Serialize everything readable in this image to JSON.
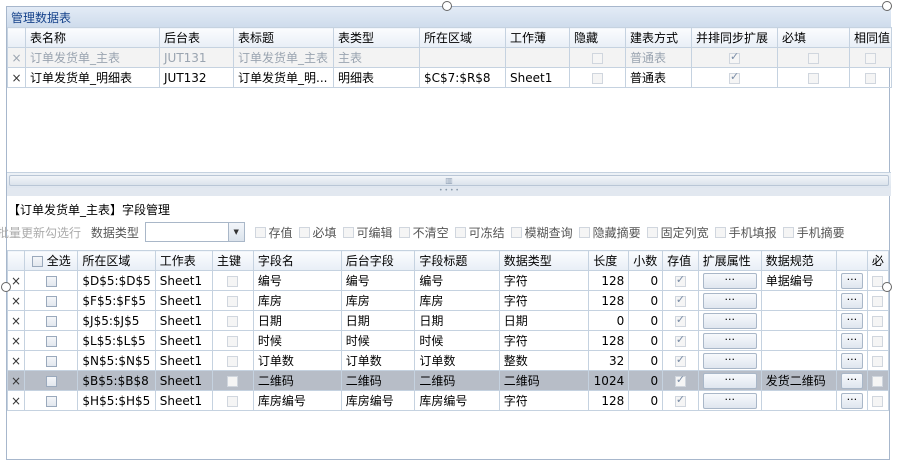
{
  "group_title": "管理数据表",
  "tables": {
    "headers": [
      "表名称",
      "后台表",
      "表标题",
      "表类型",
      "所在区域",
      "工作薄",
      "隐藏",
      "建表方式",
      "并排同步扩展",
      "必填",
      "相同值"
    ],
    "rows": [
      {
        "x": "×",
        "name": "订单发货单_主表",
        "backend": "JUT131",
        "title": "订单发货单_主表",
        "type": "主表",
        "range": "",
        "book": "",
        "hidden": false,
        "method": "普通表",
        "sync": true,
        "required": false,
        "same": false
      },
      {
        "x": "×",
        "name": "订单发货单_明细表",
        "backend": "JUT132",
        "title": "订单发货单_明...",
        "type": "明细表",
        "range": "$C$7:$R$8",
        "book": "Sheet1",
        "hidden": false,
        "method": "普通表",
        "sync": true,
        "required": false,
        "same": false
      }
    ]
  },
  "section_title": "【订单发货单_主表】字段管理",
  "toolbar": {
    "reselect": "批量更新勾选行",
    "dtype_label": "数据类型",
    "combo_value": "",
    "checks": [
      {
        "label": "存值",
        "checked": false
      },
      {
        "label": "必填",
        "checked": false
      },
      {
        "label": "可编辑",
        "checked": false
      },
      {
        "label": "不清空",
        "checked": false
      },
      {
        "label": "可冻结",
        "checked": false
      },
      {
        "label": "模糊查询",
        "checked": false
      },
      {
        "label": "隐藏摘要",
        "checked": false
      },
      {
        "label": "固定列宽",
        "checked": false
      },
      {
        "label": "手机填报",
        "checked": false
      },
      {
        "label": "手机摘要",
        "checked": false
      }
    ]
  },
  "fields": {
    "select_all": "全选",
    "headers": [
      "所在区域",
      "工作表",
      "主键",
      "字段名",
      "后台字段",
      "字段标题",
      "数据类型",
      "长度",
      "小数",
      "存值",
      "扩展属性",
      "数据规范",
      "必"
    ],
    "rows": [
      {
        "x": "×",
        "area": "$D$5:$D$5",
        "sheet": "Sheet1",
        "name": "编号",
        "backend": "编号",
        "title": "编号",
        "dtype": "字符",
        "len": "128",
        "dec": "0",
        "store": true,
        "spec": ""
      },
      {
        "x": "×",
        "area": "$F$5:$F$5",
        "sheet": "Sheet1",
        "name": "库房",
        "backend": "库房",
        "title": "库房",
        "dtype": "字符",
        "len": "128",
        "dec": "0",
        "store": true,
        "spec": ""
      },
      {
        "x": "×",
        "area": "$J$5:$J$5",
        "sheet": "Sheet1",
        "name": "日期",
        "backend": "日期",
        "title": "日期",
        "dtype": "日期",
        "len": "0",
        "dec": "0",
        "store": true,
        "spec": ""
      },
      {
        "x": "×",
        "area": "$L$5:$L$5",
        "sheet": "Sheet1",
        "name": "时候",
        "backend": "时候",
        "title": "时候",
        "dtype": "字符",
        "len": "128",
        "dec": "0",
        "store": true,
        "spec": ""
      },
      {
        "x": "×",
        "area": "$N$5:$N$5",
        "sheet": "Sheet1",
        "name": "订单数",
        "backend": "订单数",
        "title": "订单数",
        "dtype": "整数",
        "len": "32",
        "dec": "0",
        "store": true,
        "spec": ""
      },
      {
        "x": "×",
        "area": "$B$5:$B$8",
        "sheet": "Sheet1",
        "name": "二维码",
        "backend": "二维码",
        "title": "二维码",
        "dtype": "二维码",
        "len": "1024",
        "dec": "0",
        "store": true,
        "spec": "发货二维码"
      },
      {
        "x": "×",
        "area": "$H$5:$H$5",
        "sheet": "Sheet1",
        "name": "库房编号",
        "backend": "库房编号",
        "title": "库房编号",
        "dtype": "字符",
        "len": "128",
        "dec": "0",
        "store": true,
        "spec": ""
      }
    ],
    "spec_first": "单据编号",
    "dots": "···"
  }
}
